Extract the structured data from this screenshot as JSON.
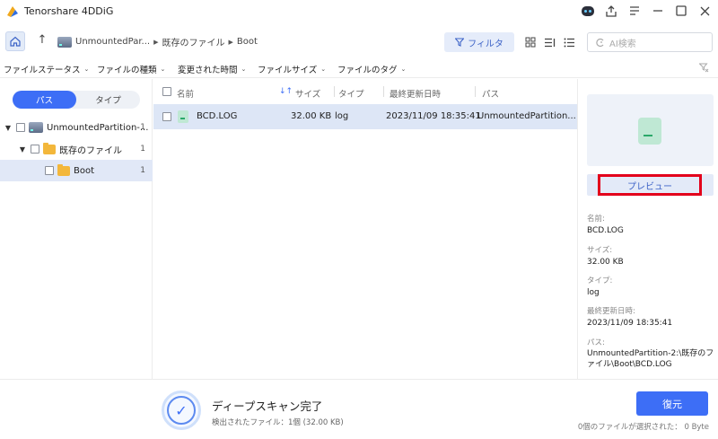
{
  "app": {
    "title": "Tenorshare 4DDiG"
  },
  "nav": {
    "crumbs": [
      "UnmountedPar...",
      "既存のファイル",
      "Boot"
    ],
    "filter_label": "フィルタ",
    "search_placeholder": "AI検索"
  },
  "filters": [
    "ファイルステータス",
    "ファイルの種類",
    "変更された時間",
    "ファイルサイズ",
    "ファイルのタグ"
  ],
  "left": {
    "tabs": [
      "パス",
      "タイプ"
    ],
    "active_tab": "パス",
    "tree": [
      {
        "label": "UnmountedPartition-...",
        "count": "1"
      },
      {
        "label": "既存のファイル",
        "count": "1"
      },
      {
        "label": "Boot",
        "count": "1"
      }
    ]
  },
  "table": {
    "headers": {
      "name": "名前",
      "size": "サイズ",
      "type": "タイプ",
      "modified": "最終更新日時",
      "path": "パス"
    },
    "rows": [
      {
        "name": "BCD.LOG",
        "size": "32.00 KB",
        "type": "log",
        "modified": "2023/11/09 18:35:41",
        "path": "UnmountedPartition..."
      }
    ]
  },
  "preview": {
    "button": "プレビュー",
    "name_label": "名前:",
    "name": "BCD.LOG",
    "size_label": "サイズ:",
    "size": "32.00 KB",
    "type_label": "タイプ:",
    "type": "log",
    "modified_label": "最終更新日時:",
    "modified": "2023/11/09 18:35:41",
    "path_label": "パス:",
    "path": "UnmountedPartition-2:\\既存のファイル\\Boot\\BCD.LOG"
  },
  "bottom": {
    "status_title": "ディープスキャン完了",
    "status_sub": "検出されたファイル：1個 (32.00 KB)",
    "recover": "復元",
    "selection": "0個のファイルが選択された： 0 Byte"
  },
  "colors": {
    "accent": "#3d6ef6",
    "highlight": "#e3001b",
    "selected_row": "#dde6f6"
  }
}
